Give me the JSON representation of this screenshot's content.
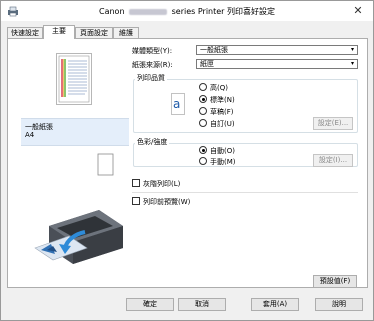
{
  "window": {
    "title_brand": "Canon",
    "title_rest": "series Printer 列印喜好設定",
    "close_glyph": "✕"
  },
  "tabs": [
    {
      "label": "快速設定"
    },
    {
      "label": "主要"
    },
    {
      "label": "頁面設定"
    },
    {
      "label": "維護"
    }
  ],
  "preview": {
    "paper_name": "一般紙張",
    "paper_size": "A4"
  },
  "media_type": {
    "label": "媒體類型(Y):",
    "value": "一般紙張"
  },
  "paper_source": {
    "label": "紙張來源(R):",
    "value": "紙匣"
  },
  "print_quality": {
    "title": "列印品質",
    "icon_glyph": "a",
    "options": [
      {
        "label": "高(Q)",
        "checked": false
      },
      {
        "label": "標準(N)",
        "checked": true
      },
      {
        "label": "草稿(F)",
        "checked": false
      },
      {
        "label": "自訂(U)",
        "checked": false
      }
    ],
    "set_button": "設定(E)..."
  },
  "color_intensity": {
    "title": "色彩/強度",
    "options": [
      {
        "label": "自動(O)",
        "checked": true
      },
      {
        "label": "手動(M)",
        "checked": false
      }
    ],
    "set_button": "設定(I)..."
  },
  "grayscale": {
    "label": "灰階列印(L)",
    "checked": false
  },
  "preview_before_print": {
    "label": "列印前預覽(W)",
    "checked": false
  },
  "defaults_button": "預設值(F)",
  "footer": {
    "ok": "確定",
    "cancel": "取消",
    "apply": "套用(A)",
    "help": "說明"
  }
}
